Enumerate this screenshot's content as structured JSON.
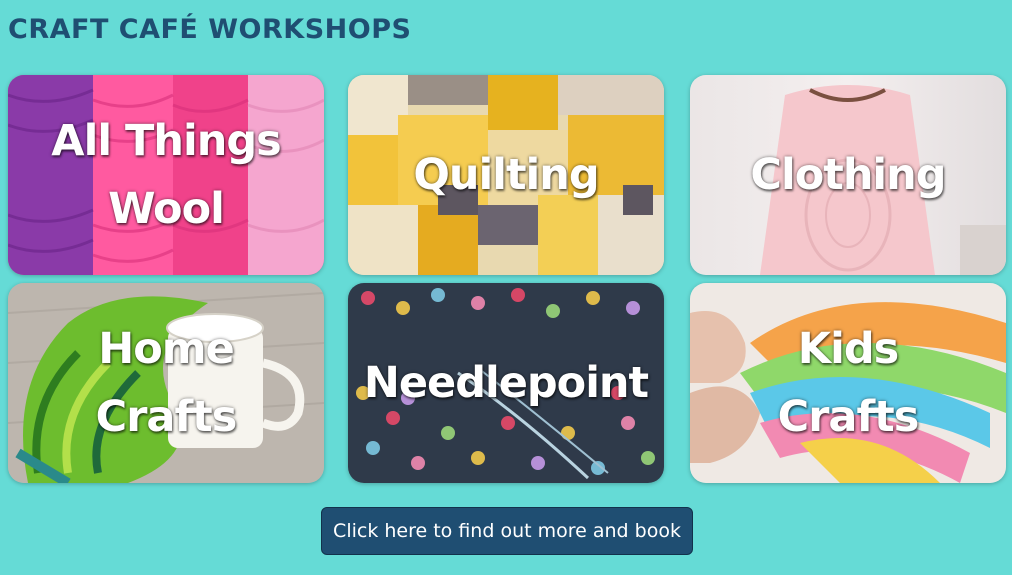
{
  "page": {
    "title": "CRAFT CAFÉ WORKSHOPS",
    "background_color": "#65dbd6",
    "title_color": "#1f4e72"
  },
  "workshops": [
    {
      "lines": [
        "All Things",
        "Wool"
      ],
      "image": "pink-and-purple-yarn-skeins"
    },
    {
      "lines": [
        "Quilting",
        ""
      ],
      "image": "yellow-patchwork-quilt"
    },
    {
      "lines": [
        "Clothing",
        ""
      ],
      "image": "pink-embroidered-blouse"
    },
    {
      "lines": [
        "Home",
        "Crafts"
      ],
      "image": "green-leaf-mug-rug-with-cup"
    },
    {
      "lines": [
        "Needlepoint",
        ""
      ],
      "image": "embroidered-flowers-on-denim"
    },
    {
      "lines": [
        "Kids",
        "Crafts"
      ],
      "image": "colorful-play-dough"
    }
  ],
  "cta": {
    "label": "Click here to find out more and book",
    "color": "#1f4e72"
  }
}
